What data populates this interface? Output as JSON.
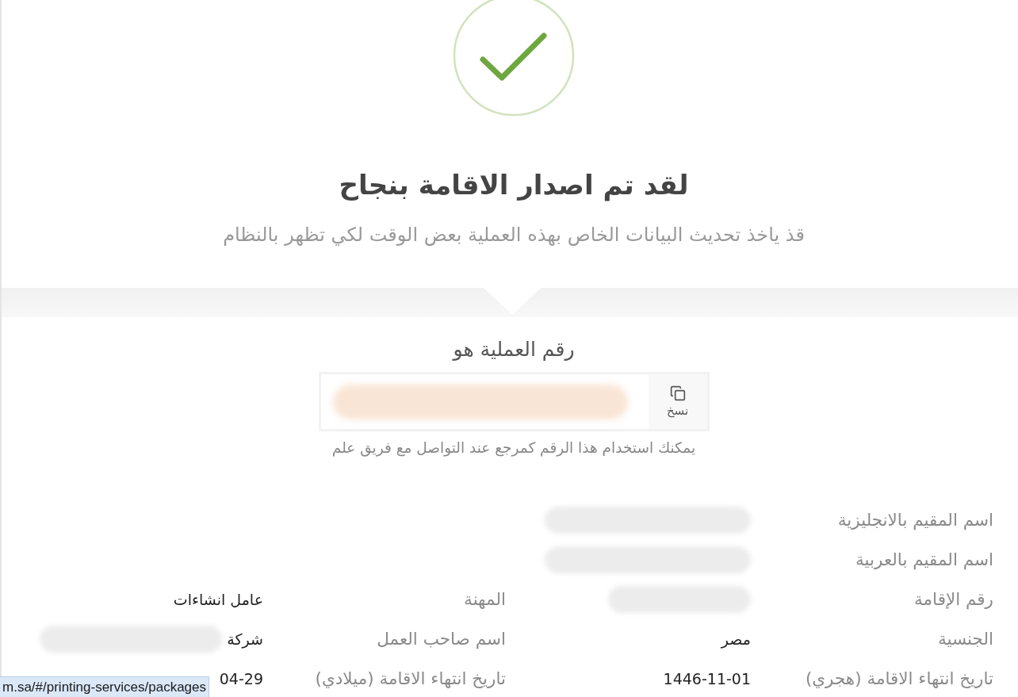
{
  "confirmation": {
    "title": "لقد تم اصدار الاقامة بنجاح",
    "subtitle": "قذ ياخذ تحديث البيانات الخاص بهذه العملية بعض الوقت لكي تظهر بالنظام"
  },
  "operation": {
    "label": "رقم العملية هو",
    "number_redacted": true,
    "copy_button": "نسخ",
    "hint": "يمكنك استخدام هذا الرقم كمرجع عند التواصل مع فريق علم"
  },
  "details": [
    {
      "fields": [
        {
          "label": "اسم المقيم بالانجليزية",
          "redacted": true
        }
      ]
    },
    {
      "fields": [
        {
          "label": "اسم المقيم بالعربية",
          "redacted": true
        }
      ]
    },
    {
      "fields": [
        {
          "label": "رقم الإقامة",
          "redacted": true
        },
        {
          "label": "المهنة",
          "value": "عامل انشاءات"
        }
      ]
    },
    {
      "fields": [
        {
          "label": "الجنسية",
          "value": "مصر"
        },
        {
          "label": "اسم صاحب العمل",
          "value": "شركة",
          "redacted": true
        }
      ]
    },
    {
      "fields": [
        {
          "label": "تاريخ انتهاء الاقامة (هجري)",
          "value": "1446-11-01"
        },
        {
          "label": "تاريخ انتهاء الاقامة (ميلادي)",
          "value": "04-29"
        }
      ]
    }
  ],
  "status_bar": {
    "url": "m.sa/#/printing-services/packages"
  }
}
